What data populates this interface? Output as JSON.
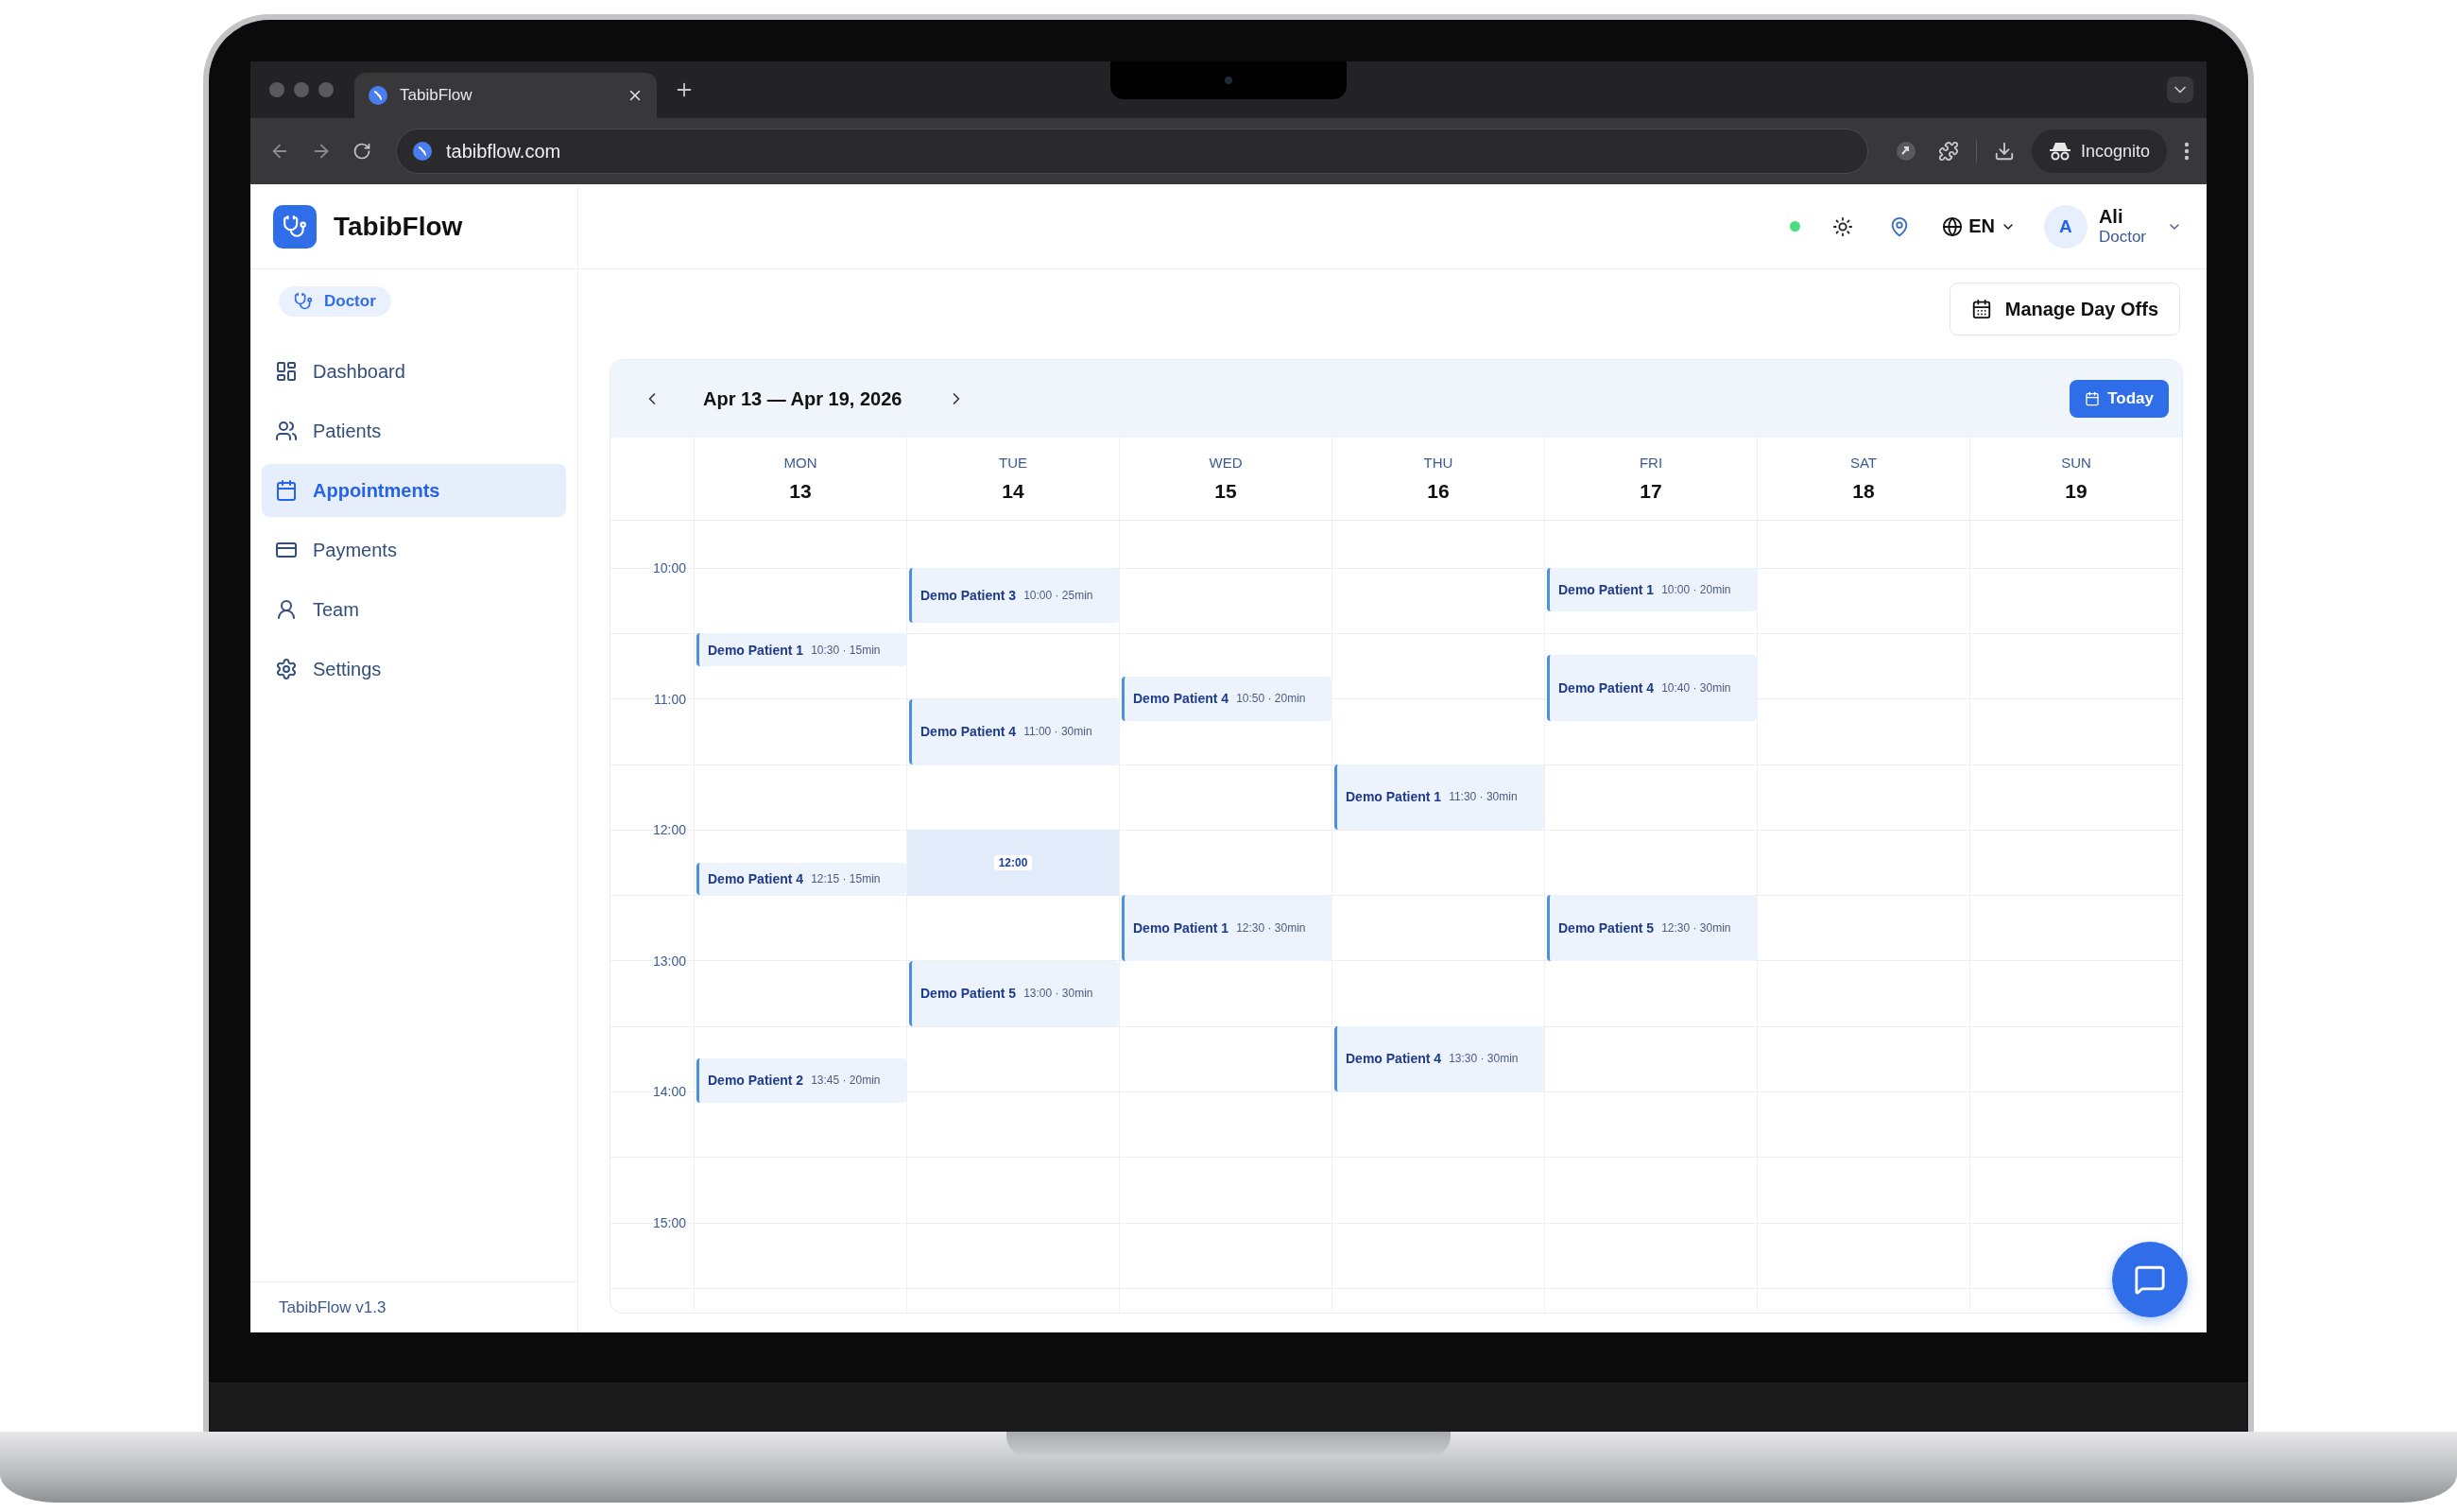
{
  "browser": {
    "tab_title": "TabibFlow",
    "url": "tabibflow.com",
    "profile": "Incognito"
  },
  "sidebar": {
    "brand": "TabibFlow",
    "role_badge": "Doctor",
    "items": [
      {
        "label": "Dashboard",
        "selected": false
      },
      {
        "label": "Patients",
        "selected": false
      },
      {
        "label": "Appointments",
        "selected": true
      },
      {
        "label": "Payments",
        "selected": false
      },
      {
        "label": "Team",
        "selected": false
      },
      {
        "label": "Settings",
        "selected": false
      }
    ],
    "version": "TabibFlow v1.3"
  },
  "header": {
    "online": true,
    "language": "EN",
    "user": {
      "initial": "A",
      "name": "Ali",
      "role": "Doctor"
    }
  },
  "actions": {
    "manage_button": "Manage Day Offs"
  },
  "calendar": {
    "range": "Apr 13 — Apr 19, 2026",
    "today_button": "Today",
    "times": [
      "10:00",
      "11:00",
      "12:00",
      "13:00",
      "14:00",
      "15:00"
    ],
    "days": [
      {
        "weekday": "MON",
        "date": "13",
        "events": [
          {
            "kind": "appointment",
            "patient": "Demo Patient 1",
            "detail": "10:30 · 15min"
          },
          {
            "kind": "appointment",
            "patient": "Demo Patient 4",
            "detail": "12:15 · 15min"
          },
          {
            "kind": "appointment",
            "patient": "Demo Patient 2",
            "detail": "13:45 · 20min"
          }
        ]
      },
      {
        "weekday": "TUE",
        "date": "14",
        "events": [
          {
            "kind": "appointment",
            "patient": "Demo Patient 3",
            "detail": "10:00 · 25min"
          },
          {
            "kind": "appointment",
            "patient": "Demo Patient 4",
            "detail": "11:00 · 30min"
          },
          {
            "kind": "slot",
            "label": "12:00"
          },
          {
            "kind": "appointment",
            "patient": "Demo Patient 5",
            "detail": "13:00 · 30min"
          }
        ]
      },
      {
        "weekday": "WED",
        "date": "15",
        "events": [
          {
            "kind": "appointment",
            "patient": "Demo Patient 4",
            "detail": "10:50 · 20min"
          },
          {
            "kind": "appointment",
            "patient": "Demo Patient 1",
            "detail": "12:30 · 30min"
          }
        ]
      },
      {
        "weekday": "THU",
        "date": "16",
        "events": [
          {
            "kind": "appointment",
            "patient": "Demo Patient 1",
            "detail": "11:30 · 30min"
          },
          {
            "kind": "appointment",
            "patient": "Demo Patient 4",
            "detail": "13:30 · 30min"
          }
        ]
      },
      {
        "weekday": "FRI",
        "date": "17",
        "events": [
          {
            "kind": "appointment",
            "patient": "Demo Patient 1",
            "detail": "10:00 · 20min"
          },
          {
            "kind": "appointment",
            "patient": "Demo Patient 4",
            "detail": "10:40 · 30min"
          },
          {
            "kind": "appointment",
            "patient": "Demo Patient 5",
            "detail": "12:30 · 30min"
          }
        ]
      },
      {
        "weekday": "SAT",
        "date": "18"
      },
      {
        "weekday": "SUN",
        "date": "19"
      }
    ]
  }
}
